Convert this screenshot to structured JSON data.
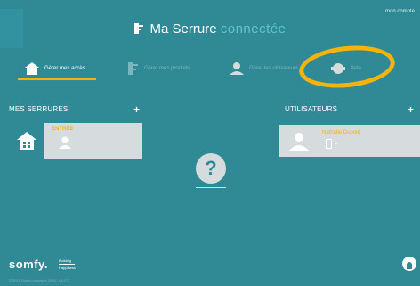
{
  "header": {
    "title_main": "Ma Serrure",
    "title_light": "connectée",
    "account_link": "mon compte"
  },
  "tabs": [
    {
      "label": "Gérer mes accès",
      "icon": "house-icon",
      "active": true
    },
    {
      "label": "Gérer mes produits",
      "icon": "key-icon",
      "active": false
    },
    {
      "label": "Gérer les utilisateurs",
      "icon": "person-icon",
      "active": false
    },
    {
      "label": "Aide",
      "icon": "help-bubble-icon",
      "active": false
    }
  ],
  "locks": {
    "title": "MES SERRURES",
    "items": [
      {
        "name": "ENTRÉE"
      }
    ]
  },
  "users": {
    "title": "UTILISATEURS",
    "items": [
      {
        "name": "Nathalie Dupont"
      }
    ]
  },
  "help": {
    "symbol": "?"
  },
  "footer": {
    "brand": "somfy.",
    "brand_sub_1": "Building",
    "brand_sub_2": "Happiness",
    "copyright": "© 2016 Somfy copyright 2015 - v4.0.7"
  },
  "colors": {
    "background": "#2f8a96",
    "accent": "#f5b30c",
    "card": "#d6dcdd"
  }
}
